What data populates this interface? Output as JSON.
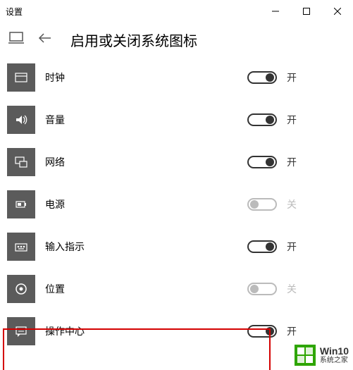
{
  "window": {
    "title": "设置"
  },
  "page": {
    "title": "启用或关闭系统图标"
  },
  "toggle_labels": {
    "on": "开",
    "off": "关"
  },
  "items": [
    {
      "label": "时钟",
      "state": "on"
    },
    {
      "label": "音量",
      "state": "on"
    },
    {
      "label": "网络",
      "state": "on"
    },
    {
      "label": "电源",
      "state": "off"
    },
    {
      "label": "输入指示",
      "state": "on"
    },
    {
      "label": "位置",
      "state": "off"
    },
    {
      "label": "操作中心",
      "state": "on"
    }
  ],
  "watermark": {
    "brand": "Win10",
    "site": "系统之家"
  }
}
